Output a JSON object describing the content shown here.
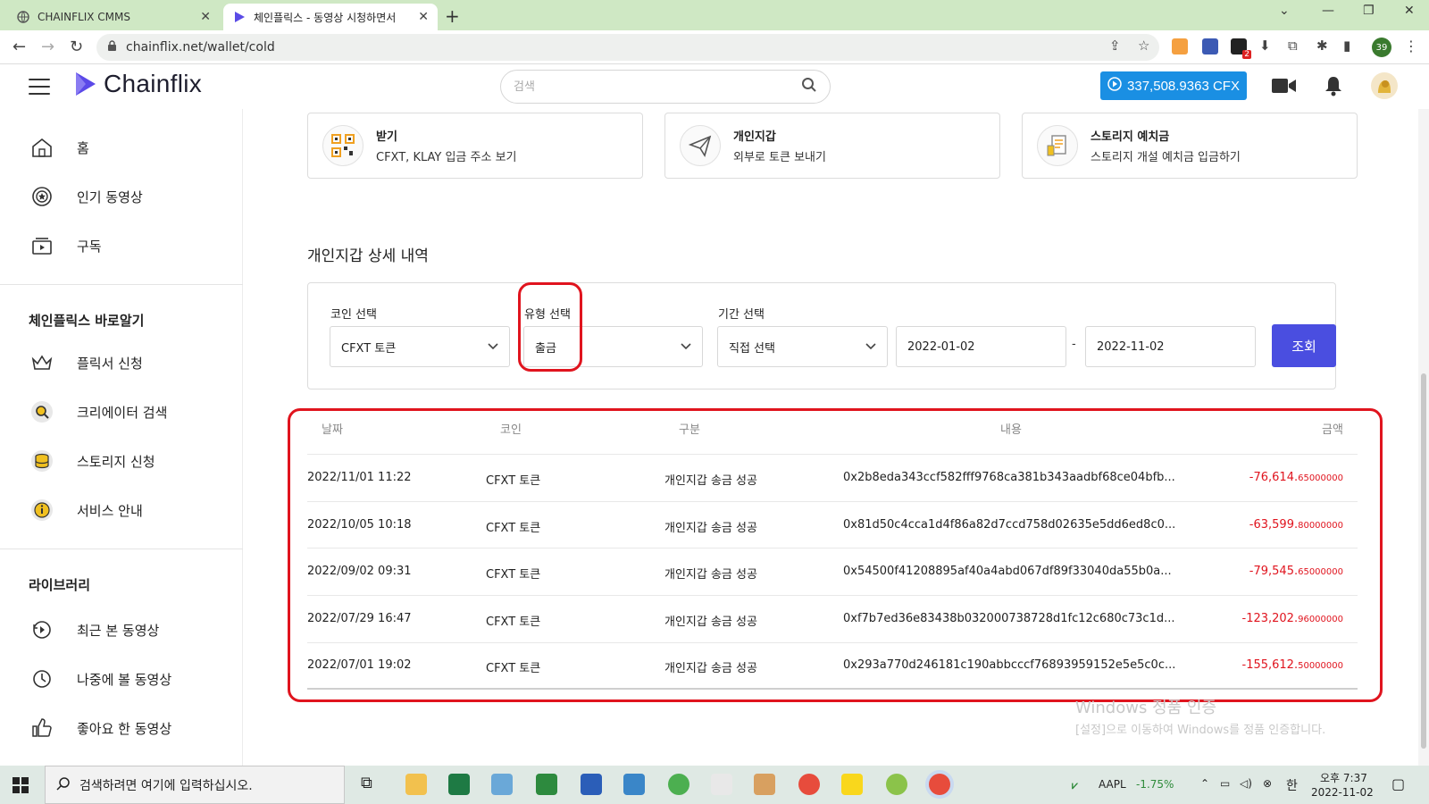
{
  "browser": {
    "tabs": [
      {
        "title": "CHAINFLIX CMMS",
        "active": false
      },
      {
        "title": "체인플릭스 - 동영상 시청하면서",
        "active": true
      }
    ],
    "url": "chainflix.net/wallet/cold",
    "profile_badge": "39",
    "ext_badge": "2"
  },
  "header": {
    "logo_text": "Chainflix",
    "search_placeholder": "검색",
    "balance": "337,508.9363 CFX"
  },
  "sidebar": {
    "main": [
      {
        "label": "홈",
        "icon": "home-icon"
      },
      {
        "label": "인기 동영상",
        "icon": "popular-icon"
      },
      {
        "label": "구독",
        "icon": "subscription-icon"
      }
    ],
    "section1_title": "체인플릭스 바로알기",
    "section1": [
      {
        "label": "플릭서 신청",
        "icon": "crown-icon"
      },
      {
        "label": "크리에이터 검색",
        "icon": "creator-search-icon"
      },
      {
        "label": "스토리지 신청",
        "icon": "storage-icon"
      },
      {
        "label": "서비스 안내",
        "icon": "info-icon"
      }
    ],
    "section2_title": "라이브러리",
    "section2": [
      {
        "label": "최근 본 동영상",
        "icon": "history-icon"
      },
      {
        "label": "나중에 볼 동영상",
        "icon": "clock-icon"
      },
      {
        "label": "좋아요 한 동영상",
        "icon": "thumbs-up-icon"
      }
    ]
  },
  "cards": [
    {
      "title": "받기",
      "desc": "CFXT, KLAY 입금 주소 보기",
      "icon": "qr-code-icon"
    },
    {
      "title": "개인지갑",
      "desc": "외부로 토큰 보내기",
      "icon": "paper-plane-icon"
    },
    {
      "title": "스토리지 예치금",
      "desc": "스토리지 개설 예치금 입금하기",
      "icon": "document-icon"
    }
  ],
  "section_title": "개인지갑 상세 내역",
  "filters": {
    "coin_label": "코인 선택",
    "coin_value": "CFXT 토큰",
    "type_label": "유형 선택",
    "type_value": "출금",
    "period_label": "기간 선택",
    "period_value": "직접 선택",
    "date_from": "2022-01-02",
    "date_sep": "-",
    "date_to": "2022-11-02",
    "query_button": "조회"
  },
  "table": {
    "headers": [
      "날짜",
      "코인",
      "구분",
      "내용",
      "금액"
    ],
    "rows": [
      {
        "date": "2022/11/01 11:22",
        "coin": "CFXT 토큰",
        "type": "개인지갑 송금 성공",
        "content": "0x2b8eda343ccf582fff9768ca381b343aadbf68ce04bfb...",
        "amount_int": "-76,614.",
        "amount_dec": "65000000"
      },
      {
        "date": "2022/10/05 10:18",
        "coin": "CFXT 토큰",
        "type": "개인지갑 송금 성공",
        "content": "0x81d50c4cca1d4f86a82d7ccd758d02635e5dd6ed8c0...",
        "amount_int": "-63,599.",
        "amount_dec": "80000000"
      },
      {
        "date": "2022/09/02 09:31",
        "coin": "CFXT 토큰",
        "type": "개인지갑 송금 성공",
        "content": "0x54500f41208895af40a4abd067df89f33040da55b0a...",
        "amount_int": "-79,545.",
        "amount_dec": "65000000"
      },
      {
        "date": "2022/07/29 16:47",
        "coin": "CFXT 토큰",
        "type": "개인지갑 송금 성공",
        "content": "0xf7b7ed36e83438b032000738728d1fc12c680c73c1d...",
        "amount_int": "-123,202.",
        "amount_dec": "96000000"
      },
      {
        "date": "2022/07/01 19:02",
        "coin": "CFXT 토큰",
        "type": "개인지갑 송금 성공",
        "content": "0x293a770d246181c190abbcccf76893959152e5e5c0c...",
        "amount_int": "-155,612.",
        "amount_dec": "50000000"
      }
    ]
  },
  "watermark": {
    "line1": "Windows 정품 인증",
    "line2": "[설정]으로 이동하여 Windows를 정품 인증합니다."
  },
  "taskbar": {
    "search_placeholder": "검색하려면 여기에 입력하십시오.",
    "stock_symbol": "AAPL",
    "stock_change": "-1.75%",
    "ime": "한",
    "time": "오후 7:37",
    "date": "2022-11-02"
  },
  "colors": {
    "accent_blue": "#1a8fe3",
    "query_button": "#4a4ee0",
    "negative_amount": "#e0141e",
    "highlight_box": "#e0141e",
    "tab_strip": "#cfe8c4"
  }
}
